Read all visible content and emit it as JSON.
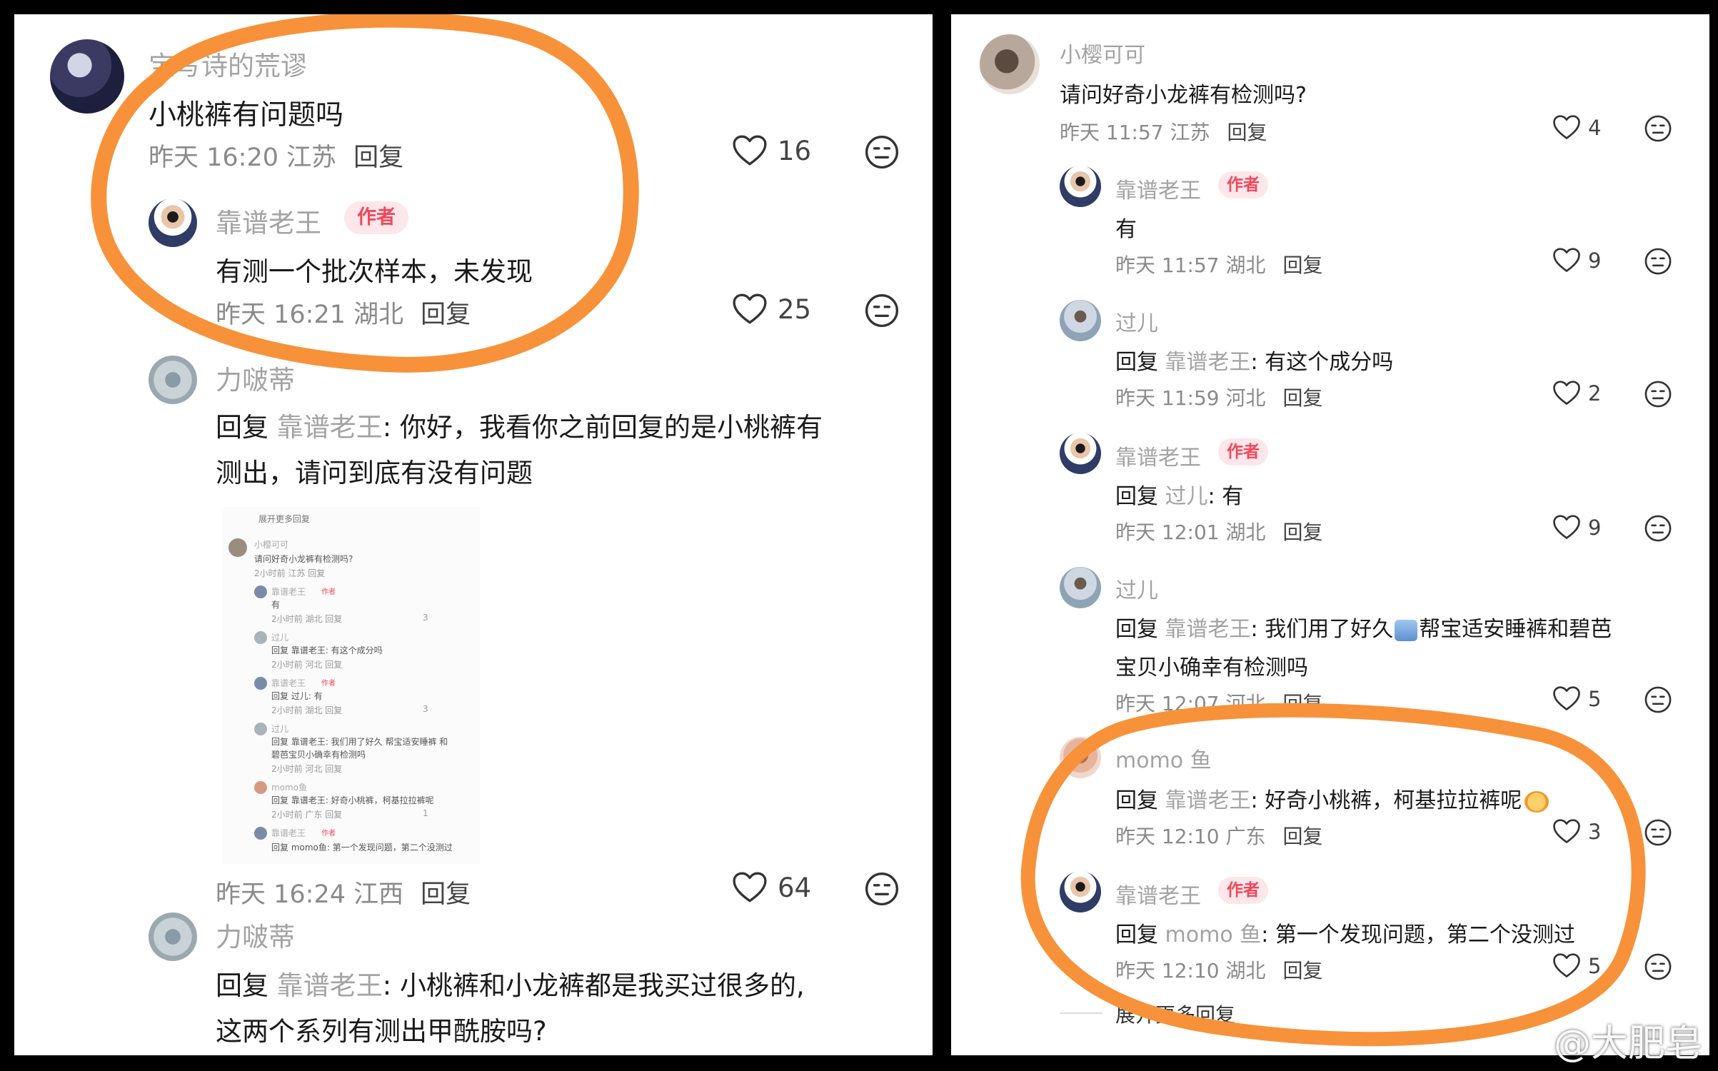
{
  "left": {
    "c1": {
      "name": "宝写诗的荒谬",
      "text": "小桃裤有问题吗",
      "time": "昨天 16:20 江苏",
      "reply": "回复",
      "likes": "16"
    },
    "c1r": {
      "name": "靠谱老王",
      "badge": "作者",
      "text": "有测一个批次样本，未发现",
      "time": "昨天 16:21 湖北",
      "reply": "回复",
      "likes": "25"
    },
    "c2": {
      "name": "力啵蒂",
      "prefix": "回复 ",
      "ref": "靠谱老王",
      "line1": ": 你好，我看你之前回复的是小桃裤有",
      "line2": "测出，请问到底有没有问题",
      "time": "昨天 16:24 江西",
      "reply": "回复",
      "likes": "64"
    },
    "c3": {
      "name": "力啵蒂",
      "prefix": "回复 ",
      "ref": "靠谱老王",
      "line1": ": 小桃裤和小龙裤都是我买过很多的,",
      "line2": "这两个系列有测出甲酰胺吗?"
    }
  },
  "embedded": {
    "expand": "展开更多回复",
    "rows": [
      {
        "name": "小樱可可",
        "text": "请问好奇小龙裤有检测吗?",
        "meta": "2小时前 江苏  回复",
        "likes": ""
      },
      {
        "name": "靠谱老王",
        "badge": "作者",
        "text": "有",
        "meta": "2小时前 湖北  回复",
        "likes": "3"
      },
      {
        "name": "过儿",
        "text": "回复 靠谱老王: 有这个成分吗",
        "meta": "2小时前 河北  回复",
        "likes": ""
      },
      {
        "name": "靠谱老王",
        "badge": "作者",
        "text": "回复 过儿: 有",
        "meta": "2小时前 湖北  回复",
        "likes": "3"
      },
      {
        "name": "过儿",
        "text": "回复 靠谱老王: 我们用了好久 帮宝适安睡裤 和",
        "text2": "碧芭宝贝小确幸有检测吗",
        "meta": "2小时前 河北  回复",
        "likes": ""
      },
      {
        "name": "momo鱼",
        "text": "回复 靠谱老王: 好奇小桃裤，柯基拉拉裤呢",
        "meta": "2小时前 广东  回复",
        "likes": "1"
      },
      {
        "name": "靠谱老王",
        "badge": "作者",
        "text": "回复 momo鱼: 第一个发现问题，第二个没测过",
        "meta": "",
        "likes": ""
      }
    ]
  },
  "right": {
    "r1": {
      "name": "小樱可可",
      "text": "请问好奇小龙裤有检测吗?",
      "time": "昨天 11:57 江苏",
      "reply": "回复",
      "likes": "4"
    },
    "r2": {
      "name": "靠谱老王",
      "badge": "作者",
      "text": "有",
      "time": "昨天 11:57 湖北",
      "reply": "回复",
      "likes": "9"
    },
    "r3": {
      "name": "过儿",
      "prefix": "回复 ",
      "ref": "靠谱老王",
      "rest": ": 有这个成分吗",
      "time": "昨天 11:59 河北",
      "reply": "回复",
      "likes": "2"
    },
    "r4": {
      "name": "靠谱老王",
      "badge": "作者",
      "prefix": "回复 ",
      "ref": "过儿",
      "rest": ": 有",
      "time": "昨天 12:01 湖北",
      "reply": "回复",
      "likes": "9"
    },
    "r5": {
      "name": "过儿",
      "prefix": "回复 ",
      "ref": "靠谱老王",
      "rest1": ": 我们用了好久",
      "rest2": "帮宝适安睡裤和碧芭",
      "line2": "宝贝小确幸有检测吗",
      "time": "昨天 12:07 河北",
      "reply": "回复",
      "likes": "5"
    },
    "r6": {
      "name": "momo 鱼",
      "prefix": "回复 ",
      "ref": "靠谱老王",
      "rest": ": 好奇小桃裤，柯基拉拉裤呢",
      "time": "昨天 12:10 广东",
      "reply": "回复",
      "likes": "3"
    },
    "r7": {
      "name": "靠谱老王",
      "badge": "作者",
      "prefix": "回复 ",
      "ref": "momo 鱼",
      "rest": ": 第一个发现问题，第二个没测过",
      "time": "昨天 12:10 湖北",
      "reply": "回复",
      "likes": "5"
    },
    "expand": "展开更多回复"
  },
  "watermark": "@大肥皂",
  "colors": {
    "highlight": "#f7923a",
    "badge_bg": "#fde7ea",
    "badge_text": "#f0485a",
    "name": "#a3a3a3"
  }
}
